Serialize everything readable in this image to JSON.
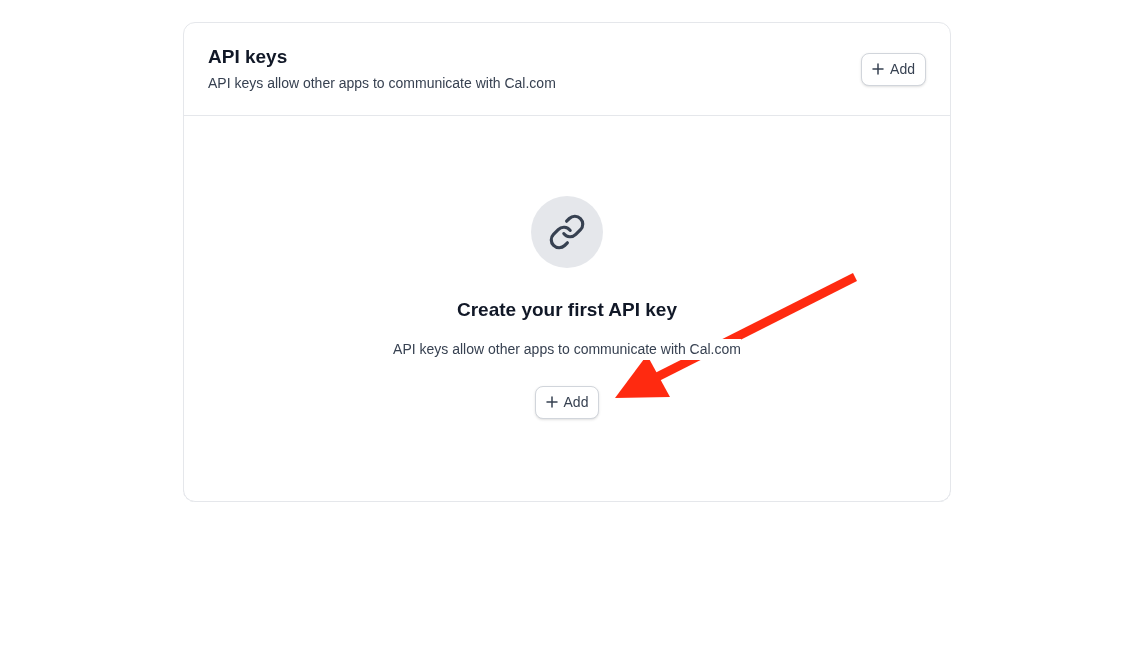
{
  "header": {
    "title": "API keys",
    "description": "API keys allow other apps to communicate with Cal.com",
    "button": {
      "label": "Add"
    }
  },
  "empty_state": {
    "title": "Create your first API key",
    "description": "API keys allow other apps to communicate with Cal.com",
    "button": {
      "label": "Add"
    }
  }
}
